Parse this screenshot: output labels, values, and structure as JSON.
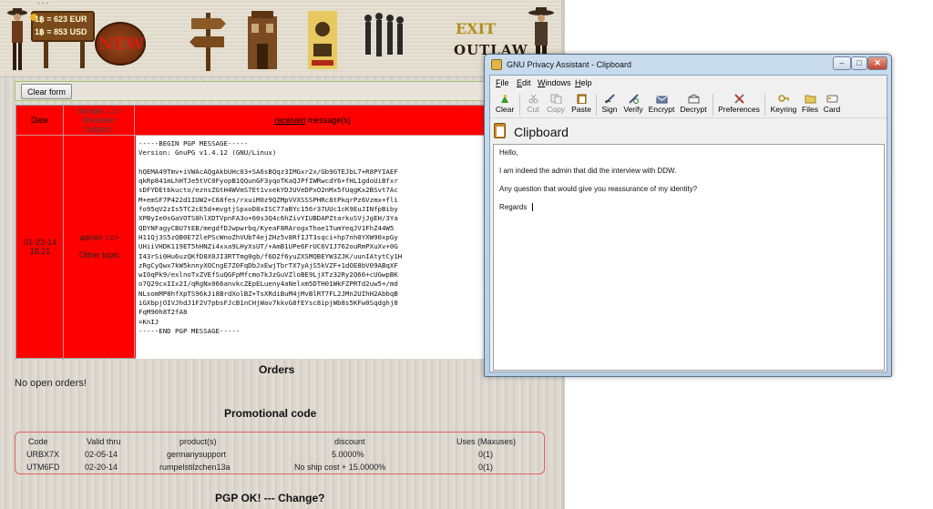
{
  "banner": {
    "scribble": "...",
    "currency_eur": "1฿ = 623 EUR",
    "currency_usd": "1฿ = 853 USD",
    "new_label": "NEW",
    "exit_label": "EXIT",
    "outlaw_label": "OUTLAW"
  },
  "form": {
    "clear_label": "Clear form"
  },
  "messages": {
    "headers": {
      "date": "Date",
      "sender": "Sender ==>",
      "receiver": "Reciever",
      "subject": "Subject:",
      "received": "received",
      "message_suffix": " message(s)"
    },
    "row": {
      "date_line1": "01-23-14",
      "date_line2": "18:21",
      "sender": "admin ==>",
      "subject": "Other topic",
      "pgp_message": "-----BEGIN PGP MESSAGE-----\nVersion: GnuPG v1.4.12 (GNU/Linux)\n\nhQEMA49Tmv+iVWAcAQgAkbUHc03+SA6sBQqz3IMGxr2x/Gb9GTEJbL7+R8PYIAEF\nqkRp841mLhHTJe5tVC0FyopB1QQunGF3yqoTKaQJPfIWRwcdY6+fHL1gdoUiBfxr\nsDFYDEtbkucto/eznsZGtH4WVmS7Et1vxekYDJUVeDPxO2nMx5fUqgKx2BSvt7Ac\nM+emSF7P422d1IUW2+C68fes/rxuiM0z9QZMpVVXSSSPHRc8tPkqrPz6Vzmx+fli\nfo95qV2zIs5TC2cE5d+mvgtjSpxoD8xISC77aBYc156r37UUc1cK9EuJINfpBiby\nXPByIe0sGaVOTS0hlXDTVpnFA3o+60s3Q4c6hZivYIUBDAPZtarkuSVjJgEH/3Ya\nQDYNFagyCBU7tEB/megdfDJwpwrbq/KyeaF8RArogxThae1TumYeqJV1FhZ44W5\nH11Qj3S5zQB0E7ZlePScWnoZhVUbT4ejZHz5v8RfIJT3sqci+hp7nh0YXW90xpGy\nUHiiVHDK119ET5hHNZi4xxa9LHyXsUT/+AmB1UPe6FrUC6V1J762ouRmPXuXv+0G\nI43rSi0Hu6uzQKfD8X0JI3RTTmg0gb/f6DZf6yuZXSMQBEYW3ZJK/uunIAtytCy1H\nzRgCyQwx7kW5knnyXOCngE7Z0FqDbJxEwjTbrTX7yAjS5kVZF+1dOE8bV09ABqXF\nwI0qPk9/exlnoTxZVEfSuQGFpMfcmo7kJzGuVZloBE9LjXTz32Ry2Q66+cUGwpBK\no7Q29cxIIx2I/qRgNx066anvkcZEpELueny4aNelxm5DTH01WkFZPRTd2uw5+/md\nNLsomMP8hfXpTS96kJi8BrdXolBZ+TsXRdiBuM4jMvBlRT7FL2JMn2UIhH2AbbqB\niGXbpjOIVJhdJ1F2V7pbsFJcB1nCHjWav7kkvG8fEYsc8ipjWb8s5KFw0Sqdghj8\nFqM90h8T2fA8\n=KnIJ\n-----END PGP MESSAGE-----"
    }
  },
  "orders": {
    "title": "Orders",
    "empty_text": "No open orders!"
  },
  "promo": {
    "title": "Promotional code",
    "columns": [
      "Code",
      "Valid thru",
      "product(s)",
      "discount",
      "Uses (Maxuses)"
    ],
    "rows": [
      [
        "URBX7X",
        "02-05-14",
        "germanysupport",
        "5.0000%",
        "0(1)"
      ],
      [
        "UTM6FD",
        "02-20-14",
        "rumpelstilzchen13a",
        "No ship cost + 15.0000%",
        "0(1)"
      ]
    ]
  },
  "pgp_status": "PGP OK! --- Change?",
  "gpa": {
    "window_title": "GNU Privacy Assistant - Clipboard",
    "minimize": "–",
    "maximize": "□",
    "close": "✕",
    "menu": [
      {
        "underline": "F",
        "rest": "ile"
      },
      {
        "underline": "E",
        "rest": "dit"
      },
      {
        "underline": "W",
        "rest": "indows"
      },
      {
        "underline": "H",
        "rest": "elp"
      }
    ],
    "toolbar": {
      "clear": "Clear",
      "cut": "Cut",
      "copy": "Copy",
      "paste": "Paste",
      "sign": "Sign",
      "verify": "Verify",
      "encrypt": "Encrypt",
      "decrypt": "Decrypt",
      "preferences": "Preferences",
      "keyring": "Keyring",
      "files": "Files",
      "card": "Card"
    },
    "clipboard_title": "Clipboard",
    "clipboard_lines": [
      "Hello,",
      "I am indeed the admin that did the interview with DDW.",
      "Any question that would give you reassurance of my identity?",
      "Regards"
    ],
    "icon_names": [
      "clear-icon",
      "cut-icon",
      "copy-icon",
      "paste-icon",
      "sign-icon",
      "verify-icon",
      "encrypt-icon",
      "decrypt-icon",
      "preferences-icon",
      "keyring-icon",
      "files-icon",
      "card-icon"
    ]
  }
}
